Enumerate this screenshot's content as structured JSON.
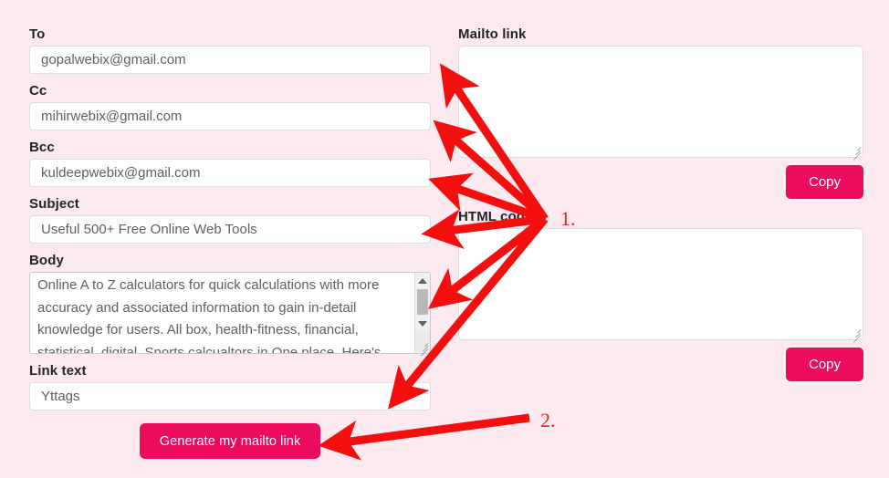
{
  "theme": {
    "background": "#fdeaf1",
    "accent": "#ec0b5c",
    "label_color": "#212529",
    "annotation_color": "#ef1c1c"
  },
  "form": {
    "fields": [
      {
        "label": "To",
        "value": "gopalwebix@gmail.com",
        "name": "to"
      },
      {
        "label": "Cc",
        "value": "mihirwebix@gmail.com",
        "name": "cc"
      },
      {
        "label": "Bcc",
        "value": "kuldeepwebix@gmail.com",
        "name": "bcc"
      },
      {
        "label": "Subject",
        "value": "Useful 500+ Free Online Web Tools",
        "name": "subject"
      }
    ],
    "body": {
      "label": "Body",
      "value": "Online A to Z calculators for quick calculations with more accuracy and associated information to gain in-detail knowledge for users. All box, health-fitness, financial, statistical, digital, Sports calcualtors in One place. Here's"
    },
    "link_text": {
      "label": "Link text",
      "value": "Yttags"
    },
    "generate_button": "Generate my mailto link"
  },
  "output": {
    "mailto": {
      "label": "Mailto link",
      "value": "",
      "copy_label": "Copy"
    },
    "html_code": {
      "label": "HTML code",
      "value": "",
      "copy_label": "Copy"
    }
  },
  "annotations": {
    "step1": "1.",
    "step2": "2."
  }
}
